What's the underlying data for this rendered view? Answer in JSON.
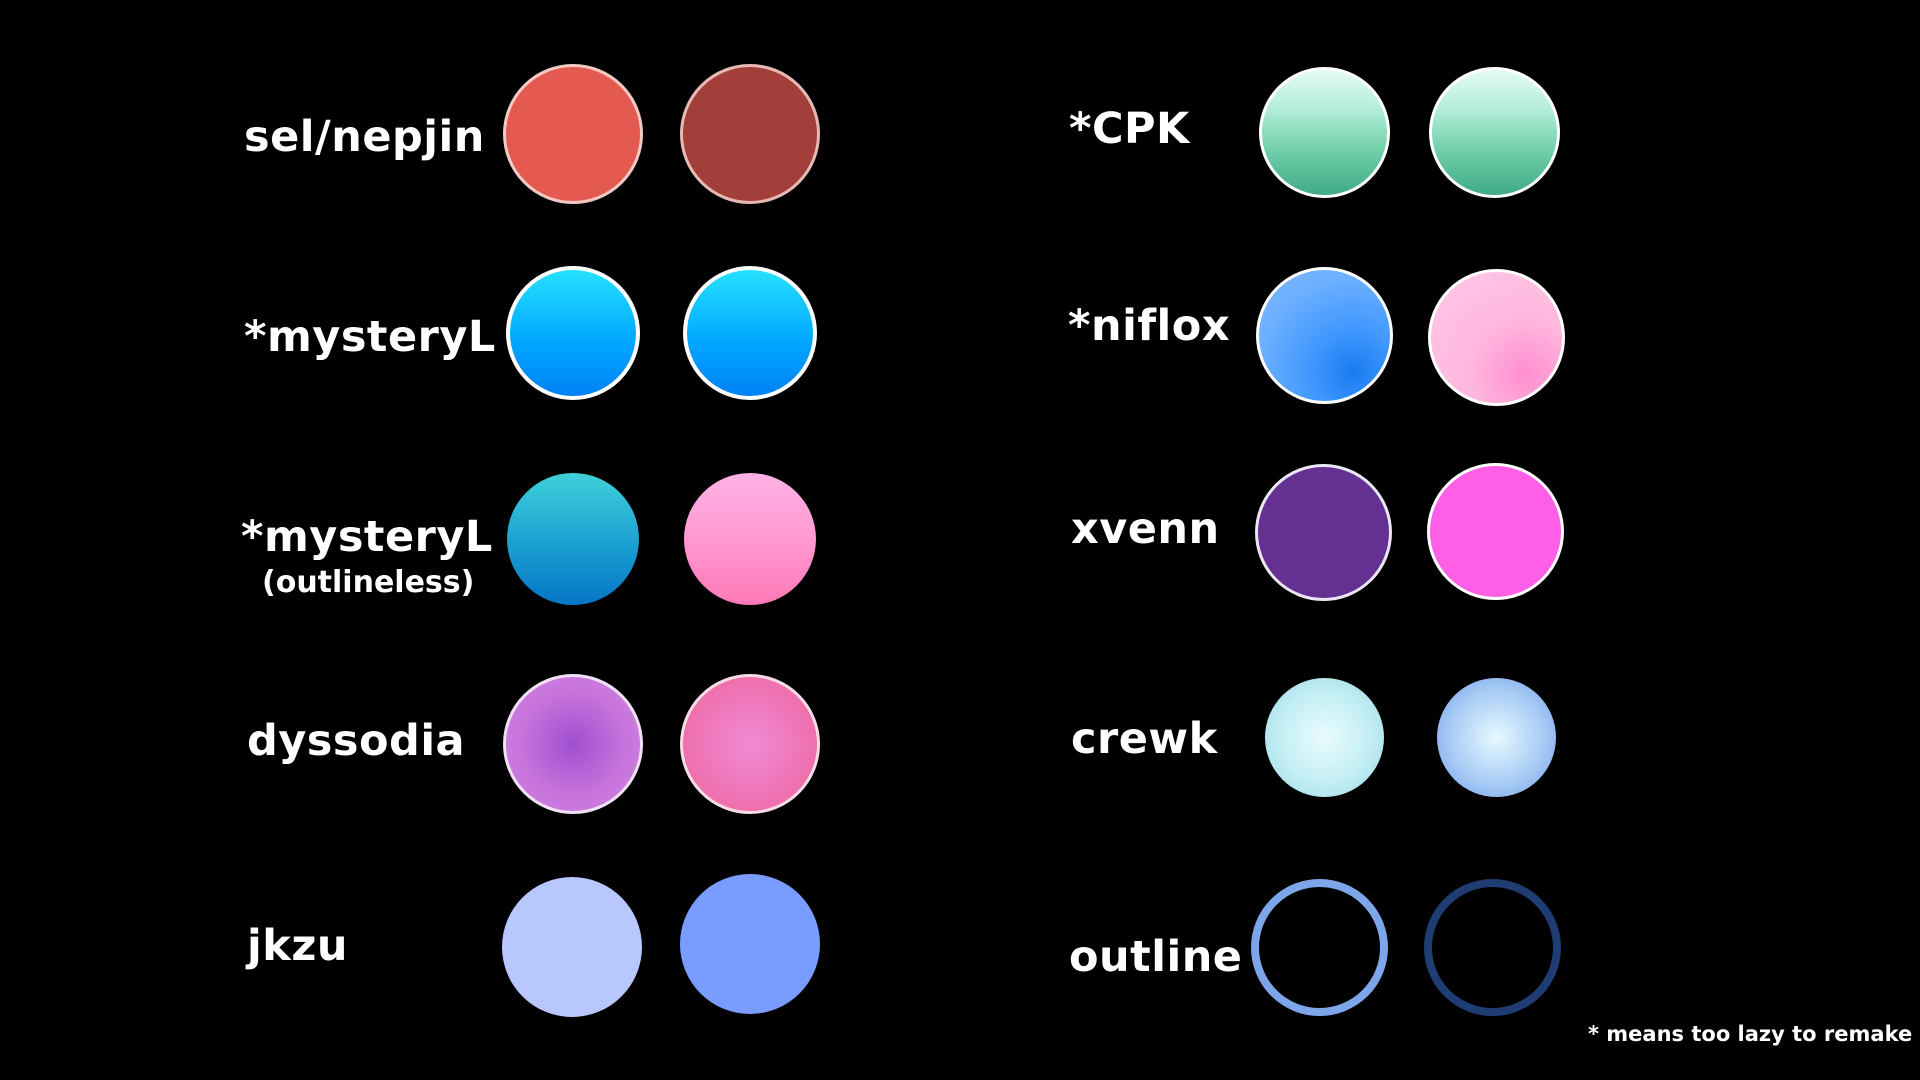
{
  "rows_left": [
    {
      "label": "sel/nepjin",
      "colors": [
        "#e45a51",
        "#a33f3b"
      ]
    },
    {
      "label": "*mysteryL",
      "colors": [
        "#00a4ff",
        "#00a4ff"
      ]
    },
    {
      "label": "*mysteryL",
      "sublabel": "(outlineless)",
      "colors": [
        "#1a9fd2",
        "#ff96cf"
      ]
    },
    {
      "label": "dyssodia",
      "colors": [
        "#c673dc",
        "#ef75b6"
      ]
    },
    {
      "label": "jkzu",
      "colors": [
        "#b8c8ff",
        "#7a9cff"
      ]
    }
  ],
  "rows_right": [
    {
      "label": "*CPK",
      "colors": [
        "#74d1ac",
        "#74d1ac"
      ]
    },
    {
      "label": "*niflox",
      "colors": [
        "#6fb1ff",
        "#ffc8e9"
      ]
    },
    {
      "label": "xvenn",
      "colors": [
        "#643193",
        "#ff5fe6"
      ]
    },
    {
      "label": "crewk",
      "colors": [
        "#c2eef3",
        "#a8ccf5"
      ]
    },
    {
      "label": "outline",
      "colors": [
        "#7da6ea",
        "#1f3d72"
      ]
    }
  ],
  "footnote": "* means too lazy to remake",
  "background": "#000000"
}
